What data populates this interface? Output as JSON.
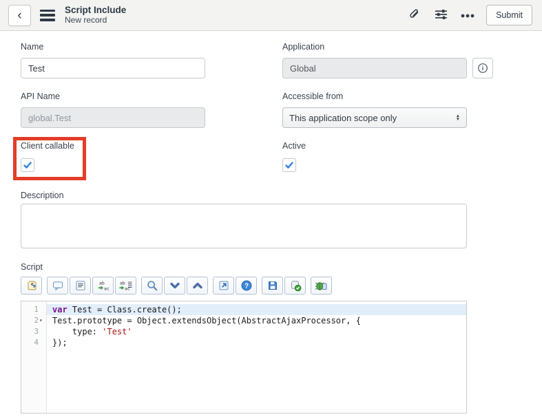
{
  "header": {
    "title": "Script Include",
    "subtitle": "New record",
    "submit_label": "Submit",
    "action_icons": [
      "attachment-icon",
      "personalize-form-icon",
      "more-options-icon"
    ]
  },
  "form": {
    "name": {
      "label": "Name",
      "value": "Test"
    },
    "application": {
      "label": "Application",
      "value": "Global",
      "readonly": true
    },
    "api_name": {
      "label": "API Name",
      "value": "global.Test",
      "readonly": true
    },
    "accessible_from": {
      "label": "Accessible from",
      "value": "This application scope only"
    },
    "client_callable": {
      "label": "Client callable",
      "checked": true
    },
    "active": {
      "label": "Active",
      "checked": true
    },
    "description": {
      "label": "Description",
      "value": ""
    },
    "script": {
      "label": "Script"
    }
  },
  "annotations": {
    "highlight_color": "#e23d28",
    "highlighted_field": "Client callable"
  },
  "colors": {
    "accent_blue": "#2f7fe0",
    "header_bg": "#f3f3f2",
    "keyword": "#7c0f8e",
    "string": "#a11616",
    "active_line_bg": "#e2eefa"
  },
  "toolbar": {
    "groups": [
      [
        "syntax-editor-macro-icon"
      ],
      [
        "toggle-comment-icon",
        "format-code-icon",
        "replace-icon",
        "replace-all-icon"
      ],
      [
        "search-icon",
        "find-next-icon",
        "find-previous-icon"
      ],
      [
        "open-in-window-icon",
        "help-icon"
      ],
      [
        "save-icon",
        "syntax-check-icon"
      ],
      [
        "run-test-icon"
      ]
    ]
  },
  "editor": {
    "lines": [
      {
        "number": "1",
        "fold": "",
        "active": true,
        "tokens": [
          {
            "t": "var",
            "c": "keyword"
          },
          {
            "t": " Test = Class.create();",
            "c": "plain"
          }
        ]
      },
      {
        "number": "2",
        "fold": "▾",
        "active": false,
        "tokens": [
          {
            "t": "Test.prototype = Object.extendsObject(AbstractAjaxProcessor, {",
            "c": "plain"
          }
        ]
      },
      {
        "number": "3",
        "fold": "",
        "active": false,
        "tokens": [
          {
            "t": "    type: ",
            "c": "plain"
          },
          {
            "t": "'Test'",
            "c": "string"
          }
        ]
      },
      {
        "number": "4",
        "fold": "",
        "active": false,
        "tokens": [
          {
            "t": "});",
            "c": "plain"
          }
        ]
      }
    ]
  }
}
